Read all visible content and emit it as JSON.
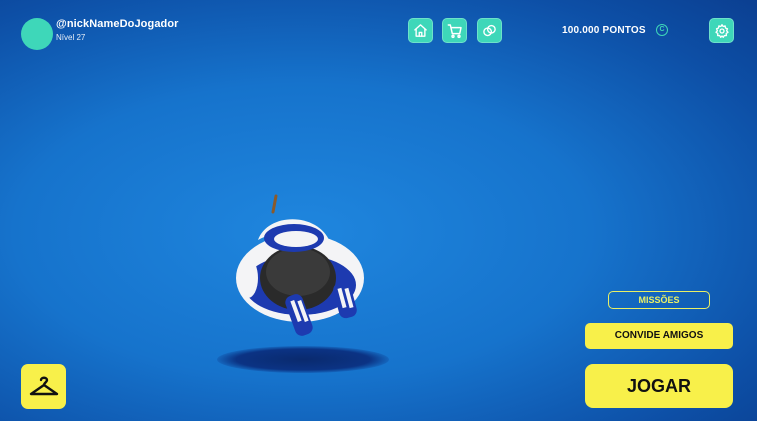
{
  "player": {
    "nickname": "@nickNameDoJogador",
    "level": "Nível 27"
  },
  "topbar": {
    "points": "100.000 PONTOS",
    "coin_symbol": "C"
  },
  "nav": [
    "home-icon",
    "cart-icon",
    "wardrobe-rings-icon",
    "settings-icon"
  ],
  "actions": {
    "missions": "MISSÕES",
    "invite": "CONVIDE AMIGOS",
    "play": "JOGAR"
  },
  "colors": {
    "accent_teal": "#3ed7b9",
    "accent_yellow": "#f8f04a",
    "background": "#1673cc"
  }
}
